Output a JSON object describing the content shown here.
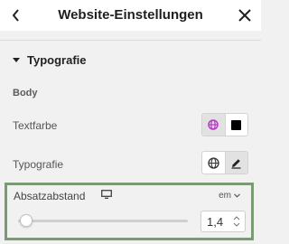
{
  "header": {
    "title": "Website-Einstellungen",
    "back_icon": "chevron-left-icon",
    "close_icon": "close-icon"
  },
  "section": {
    "title": "Typografie",
    "expanded": true
  },
  "group": {
    "label": "Body"
  },
  "rows": {
    "text_color": {
      "label": "Textfarbe",
      "global_icon": "globe-icon",
      "current_color": "#000000",
      "global_color": "#b838c8"
    },
    "typography": {
      "label": "Typografie",
      "global_icon": "globe-icon",
      "edit_icon": "pencil-icon"
    }
  },
  "paragraph_spacing": {
    "label": "Absatzabstand",
    "device_icon": "desktop-icon",
    "unit": "em",
    "value": "1,4",
    "slider_fraction": 0.05,
    "highlight_color": "#7a9a74"
  }
}
